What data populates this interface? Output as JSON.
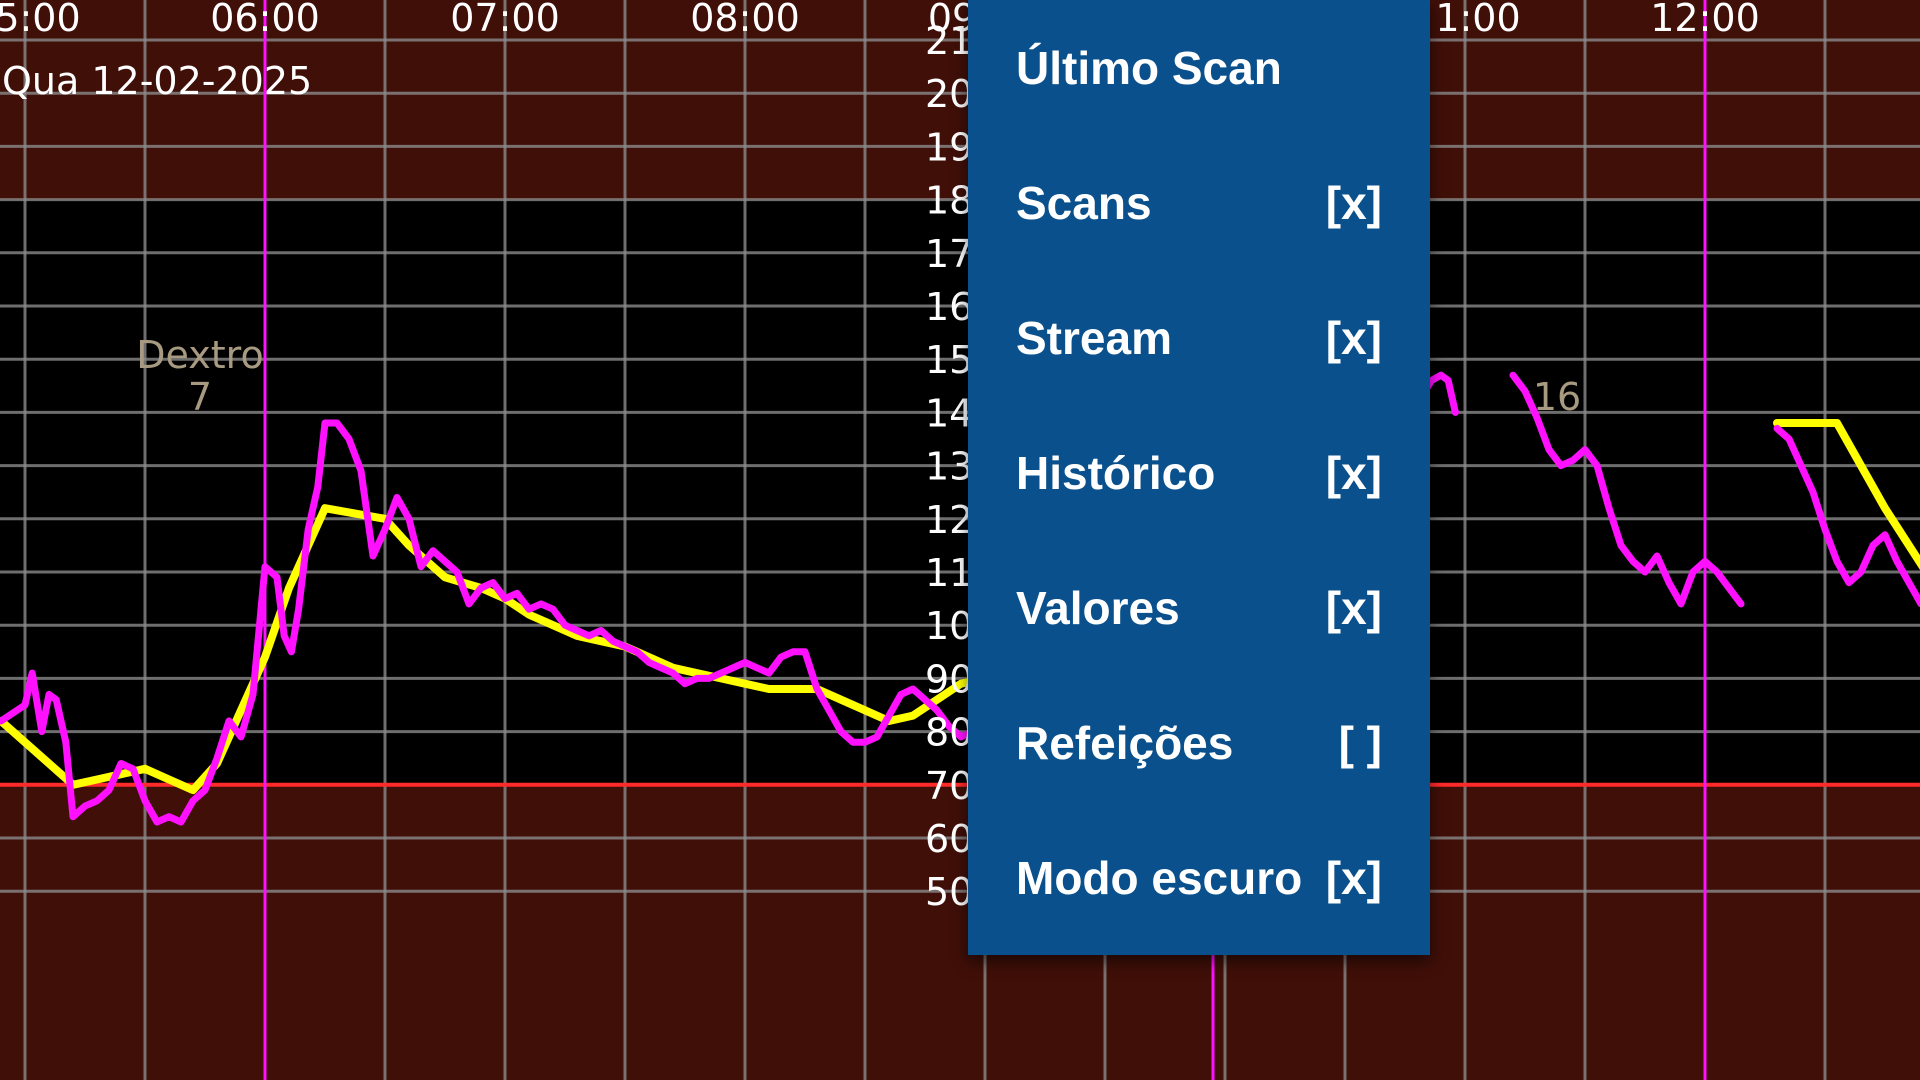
{
  "colors": {
    "background": "#000000",
    "out_of_range_band": "#3f0f08",
    "grid": "#8a8a8a",
    "target_line": "#ff2a2a",
    "stream_line": "#ff10ff",
    "history_line": "#ffff00",
    "menu_bg": "#0a508c",
    "menu_text": "#ffffff",
    "annotation": "#a89a80"
  },
  "chart": {
    "date_label": "Qua 12-02-2025",
    "time_labels": [
      "5:00",
      "06:00",
      "07:00",
      "08:00",
      "09",
      "1:00",
      "12:00"
    ],
    "y_labels": [
      "21",
      "20",
      "19",
      "18",
      "17",
      "16",
      "15",
      "14",
      "13",
      "12",
      "11",
      "10",
      "90",
      "80",
      "70",
      "60",
      "50"
    ],
    "annotations": [
      {
        "text": "Dextro",
        "value": "7"
      },
      {
        "text": "",
        "value": "16"
      }
    ]
  },
  "chart_data": {
    "type": "line",
    "title": "",
    "ylim": [
      50,
      220
    ],
    "target_low": 70,
    "x_unit": "time (h)",
    "series": [
      {
        "name": "Stream",
        "color": "#ff10ff",
        "segments": [
          [
            [
              4.9,
              82
            ],
            [
              5.0,
              85
            ],
            [
              5.03,
              91
            ],
            [
              5.07,
              80
            ],
            [
              5.1,
              87
            ],
            [
              5.13,
              86
            ],
            [
              5.17,
              78
            ],
            [
              5.2,
              64
            ],
            [
              5.25,
              66
            ],
            [
              5.3,
              67
            ],
            [
              5.35,
              69
            ],
            [
              5.4,
              74
            ],
            [
              5.45,
              73
            ],
            [
              5.5,
              67
            ],
            [
              5.55,
              63
            ],
            [
              5.6,
              64
            ],
            [
              5.65,
              63
            ],
            [
              5.7,
              67
            ],
            [
              5.75,
              69
            ],
            [
              5.8,
              75
            ],
            [
              5.85,
              82
            ],
            [
              5.9,
              79
            ],
            [
              5.95,
              87
            ],
            [
              6.0,
              111
            ],
            [
              6.05,
              109
            ],
            [
              6.08,
              98
            ],
            [
              6.11,
              95
            ],
            [
              6.14,
              103
            ],
            [
              6.18,
              118
            ],
            [
              6.22,
              126
            ],
            [
              6.25,
              138
            ],
            [
              6.3,
              138
            ],
            [
              6.35,
              135
            ],
            [
              6.4,
              129
            ],
            [
              6.45,
              113
            ],
            [
              6.5,
              118
            ],
            [
              6.55,
              124
            ],
            [
              6.6,
              120
            ],
            [
              6.65,
              111
            ],
            [
              6.7,
              114
            ],
            [
              6.75,
              112
            ],
            [
              6.8,
              110
            ],
            [
              6.85,
              104
            ],
            [
              6.9,
              107
            ],
            [
              6.95,
              108
            ],
            [
              7.0,
              105
            ],
            [
              7.05,
              106
            ],
            [
              7.1,
              103
            ],
            [
              7.15,
              104
            ],
            [
              7.2,
              103
            ],
            [
              7.25,
              100
            ],
            [
              7.3,
              99
            ],
            [
              7.35,
              98
            ],
            [
              7.4,
              99
            ],
            [
              7.45,
              97
            ],
            [
              7.5,
              96
            ],
            [
              7.55,
              95
            ],
            [
              7.6,
              93
            ],
            [
              7.65,
              92
            ],
            [
              7.7,
              91
            ],
            [
              7.75,
              89
            ],
            [
              7.8,
              90
            ],
            [
              7.85,
              90
            ],
            [
              7.9,
              91
            ],
            [
              7.95,
              92
            ],
            [
              8.0,
              93
            ],
            [
              8.05,
              92
            ],
            [
              8.1,
              91
            ],
            [
              8.15,
              94
            ],
            [
              8.2,
              95
            ],
            [
              8.25,
              95
            ],
            [
              8.3,
              88
            ],
            [
              8.35,
              84
            ],
            [
              8.4,
              80
            ],
            [
              8.45,
              78
            ],
            [
              8.5,
              78
            ],
            [
              8.55,
              79
            ],
            [
              8.6,
              83
            ],
            [
              8.65,
              87
            ],
            [
              8.7,
              88
            ],
            [
              8.75,
              86
            ],
            [
              8.8,
              84
            ],
            [
              8.85,
              81
            ],
            [
              8.9,
              79
            ],
            [
              8.95,
              80
            ],
            [
              9.0,
              75
            ],
            [
              9.03,
              70
            ],
            [
              9.06,
              68
            ]
          ],
          [
            [
              9.9,
              136
            ],
            [
              9.95,
              133
            ],
            [
              10.0,
              128
            ],
            [
              10.05,
              122
            ],
            [
              10.1,
              116
            ],
            [
              10.15,
              108
            ],
            [
              10.2,
              100
            ],
            [
              10.22,
              92
            ],
            [
              10.25,
              80
            ],
            [
              10.3,
              73
            ],
            [
              10.35,
              78
            ],
            [
              10.4,
              87
            ],
            [
              10.45,
              96
            ],
            [
              10.5,
              100
            ],
            [
              10.55,
              105
            ],
            [
              10.6,
              112
            ],
            [
              10.65,
              118
            ],
            [
              10.7,
              124
            ],
            [
              10.75,
              130
            ],
            [
              10.78,
              138
            ],
            [
              10.82,
              143
            ],
            [
              10.86,
              146
            ],
            [
              10.9,
              147
            ],
            [
              10.93,
              146
            ],
            [
              10.96,
              140
            ]
          ],
          [
            [
              11.2,
              147
            ],
            [
              11.25,
              144
            ],
            [
              11.3,
              139
            ],
            [
              11.35,
              133
            ],
            [
              11.4,
              130
            ],
            [
              11.45,
              131
            ],
            [
              11.5,
              133
            ],
            [
              11.55,
              130
            ],
            [
              11.6,
              122
            ],
            [
              11.65,
              115
            ],
            [
              11.7,
              112
            ],
            [
              11.75,
              110
            ],
            [
              11.8,
              113
            ],
            [
              11.85,
              108
            ],
            [
              11.9,
              104
            ],
            [
              11.95,
              110
            ],
            [
              12.0,
              112
            ],
            [
              12.05,
              110
            ],
            [
              12.1,
              107
            ],
            [
              12.15,
              104
            ]
          ],
          [
            [
              12.3,
              137
            ],
            [
              12.35,
              135
            ],
            [
              12.4,
              130
            ],
            [
              12.45,
              125
            ],
            [
              12.5,
              118
            ],
            [
              12.55,
              112
            ],
            [
              12.6,
              108
            ],
            [
              12.65,
              110
            ],
            [
              12.7,
              115
            ],
            [
              12.75,
              117
            ],
            [
              12.8,
              112
            ],
            [
              12.85,
              108
            ],
            [
              12.9,
              104
            ],
            [
              12.95,
              106
            ],
            [
              13.0,
              110
            ],
            [
              13.05,
              113
            ],
            [
              13.1,
              109
            ],
            [
              13.15,
              105
            ]
          ]
        ]
      },
      {
        "name": "Histórico",
        "color": "#ffff00",
        "segments": [
          [
            [
              4.9,
              82
            ],
            [
              5.0,
              78
            ],
            [
              5.1,
              74
            ],
            [
              5.2,
              70
            ],
            [
              5.3,
              71
            ],
            [
              5.4,
              72
            ],
            [
              5.5,
              73
            ],
            [
              5.6,
              71
            ],
            [
              5.7,
              69
            ],
            [
              5.8,
              74
            ],
            [
              5.9,
              84
            ],
            [
              6.0,
              94
            ],
            [
              6.1,
              107
            ],
            [
              6.2,
              117
            ],
            [
              6.25,
              122
            ],
            [
              6.5,
              120
            ],
            [
              6.6,
              115
            ],
            [
              6.75,
              109
            ],
            [
              6.9,
              107
            ],
            [
              7.0,
              105
            ],
            [
              7.1,
              102
            ],
            [
              7.2,
              100
            ],
            [
              7.3,
              98
            ],
            [
              7.4,
              97
            ],
            [
              7.5,
              96
            ],
            [
              7.6,
              94
            ],
            [
              7.7,
              92
            ],
            [
              7.8,
              91
            ],
            [
              7.9,
              90
            ],
            [
              8.0,
              89
            ],
            [
              8.1,
              88
            ],
            [
              8.2,
              88
            ],
            [
              8.3,
              88
            ],
            [
              8.4,
              86
            ],
            [
              8.5,
              84
            ],
            [
              8.6,
              82
            ],
            [
              8.7,
              83
            ],
            [
              8.8,
              86
            ],
            [
              8.9,
              89
            ],
            [
              9.0,
              90
            ]
          ],
          [
            [
              9.9,
              143
            ],
            [
              10.0,
              138
            ],
            [
              10.1,
              131
            ],
            [
              10.2,
              124
            ],
            [
              10.3,
              116
            ],
            [
              10.4,
              108
            ],
            [
              10.5,
              100
            ],
            [
              10.6,
              94
            ],
            [
              10.7,
              88
            ]
          ],
          [
            [
              12.3,
              138
            ],
            [
              12.55,
              138
            ],
            [
              12.65,
              130
            ],
            [
              12.75,
              122
            ],
            [
              12.85,
              115
            ],
            [
              12.95,
              108
            ],
            [
              13.05,
              100
            ],
            [
              13.15,
              95
            ]
          ]
        ]
      }
    ]
  },
  "menu": {
    "items": [
      {
        "label": "Último Scan",
        "check": ""
      },
      {
        "label": "Scans",
        "check": "[x]"
      },
      {
        "label": "Stream",
        "check": "[x]"
      },
      {
        "label": "Histórico",
        "check": "[x]"
      },
      {
        "label": "Valores",
        "check": "[x]"
      },
      {
        "label": "Refeições",
        "check": "[ ]"
      },
      {
        "label": "Modo escuro",
        "check": "[x]"
      }
    ]
  }
}
